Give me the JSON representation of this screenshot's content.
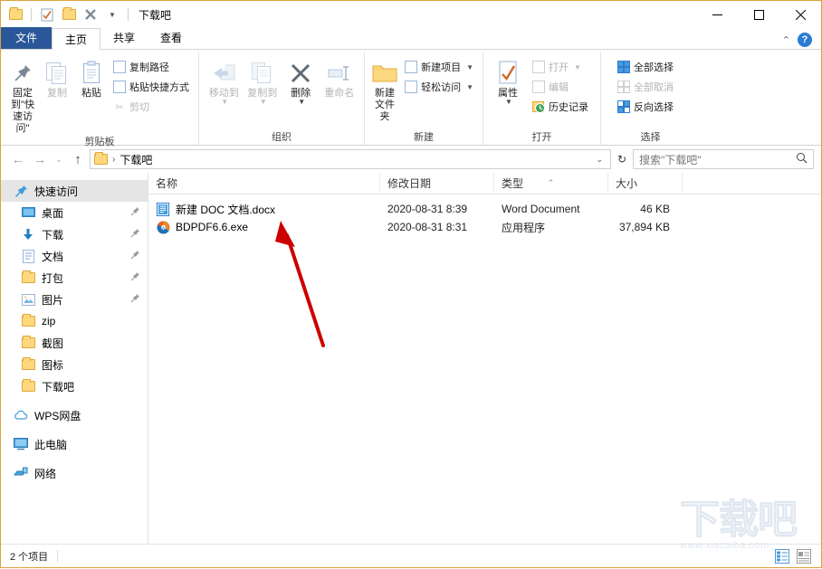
{
  "window": {
    "title": "下载吧",
    "quick_access": [
      {
        "name": "folder-icon",
        "label": "文件夹"
      },
      {
        "name": "properties-icon",
        "label": "属性"
      },
      {
        "name": "new-folder-icon",
        "label": "新建文件夹"
      },
      {
        "name": "delete-icon",
        "label": "删除"
      },
      {
        "name": "customize-icon",
        "label": "自定义快速访问工具栏"
      }
    ],
    "controls": {
      "minimize": "—",
      "maximize": "☐",
      "close": "✕"
    }
  },
  "tabs": [
    {
      "label": "文件",
      "type": "file"
    },
    {
      "label": "主页",
      "type": "active"
    },
    {
      "label": "共享",
      "type": "normal"
    },
    {
      "label": "查看",
      "type": "normal"
    }
  ],
  "ribbon": {
    "collapse_icon": "⌃",
    "help_icon": "?",
    "groups": [
      {
        "label": "剪贴板",
        "big": [
          {
            "label": "固定到\"快速访问\"",
            "icon": "pin-icon",
            "disabled": false
          },
          {
            "label": "复制",
            "icon": "copy-icon",
            "disabled": true
          },
          {
            "label": "粘贴",
            "icon": "paste-icon",
            "disabled": false
          }
        ],
        "small": [
          {
            "label": "复制路径",
            "icon": "copy-path-icon",
            "disabled": false
          },
          {
            "label": "粘贴快捷方式",
            "icon": "paste-shortcut-icon",
            "disabled": false
          },
          {
            "label": "剪切",
            "icon": "cut-icon",
            "disabled": true
          }
        ]
      },
      {
        "label": "组织",
        "big": [
          {
            "label": "移动到",
            "icon": "move-to-icon",
            "disabled": true,
            "caret": true
          },
          {
            "label": "复制到",
            "icon": "copy-to-icon",
            "disabled": true,
            "caret": true
          },
          {
            "label": "删除",
            "icon": "delete-icon",
            "disabled": false,
            "caret": true
          },
          {
            "label": "重命名",
            "icon": "rename-icon",
            "disabled": true
          }
        ]
      },
      {
        "label": "新建",
        "big": [
          {
            "label": "新建文件夹",
            "icon": "new-folder-icon",
            "disabled": false
          }
        ],
        "small": [
          {
            "label": "新建项目",
            "icon": "new-item-icon",
            "disabled": false,
            "caret": true
          },
          {
            "label": "轻松访问",
            "icon": "easy-access-icon",
            "disabled": false,
            "caret": true
          }
        ]
      },
      {
        "label": "打开",
        "big": [
          {
            "label": "属性",
            "icon": "properties-icon",
            "disabled": false,
            "caret": true
          }
        ],
        "small": [
          {
            "label": "打开",
            "icon": "open-icon",
            "disabled": true,
            "caret": true
          },
          {
            "label": "编辑",
            "icon": "edit-icon",
            "disabled": true
          },
          {
            "label": "历史记录",
            "icon": "history-icon",
            "disabled": false
          }
        ]
      },
      {
        "label": "选择",
        "small": [
          {
            "label": "全部选择",
            "icon": "select-all-icon",
            "disabled": false
          },
          {
            "label": "全部取消",
            "icon": "select-none-icon",
            "disabled": true
          },
          {
            "label": "反向选择",
            "icon": "invert-selection-icon",
            "disabled": false
          }
        ]
      }
    ]
  },
  "addressbar": {
    "back_icon": "←",
    "forward_icon": "→",
    "recent_icon": "⌄",
    "up_icon": "↑",
    "path": "下载吧",
    "crumb_sep": "›",
    "dropdown_icon": "⌄",
    "refresh_icon": "↻"
  },
  "search": {
    "placeholder": "搜索\"下载吧\"",
    "icon": "search-icon"
  },
  "sidebar": {
    "items": [
      {
        "label": "快速访问",
        "icon": "quick-access-star-icon",
        "selected": true,
        "root": true,
        "pinned": false
      },
      {
        "label": "桌面",
        "icon": "desktop-icon",
        "pinned": true
      },
      {
        "label": "下载",
        "icon": "downloads-icon",
        "pinned": true
      },
      {
        "label": "文档",
        "icon": "documents-icon",
        "pinned": true
      },
      {
        "label": "打包",
        "icon": "folder-icon",
        "pinned": true
      },
      {
        "label": "图片",
        "icon": "pictures-icon",
        "pinned": true
      },
      {
        "label": "zip",
        "icon": "folder-icon",
        "pinned": false
      },
      {
        "label": "截图",
        "icon": "folder-icon",
        "pinned": false
      },
      {
        "label": "图标",
        "icon": "folder-icon",
        "pinned": false
      },
      {
        "label": "下载吧",
        "icon": "folder-icon",
        "pinned": false
      },
      {
        "label": "WPS网盘",
        "icon": "cloud-icon",
        "root": true,
        "gap": true,
        "pinned": false
      },
      {
        "label": "此电脑",
        "icon": "this-pc-icon",
        "root": true,
        "gap": true,
        "pinned": false
      },
      {
        "label": "网络",
        "icon": "network-icon",
        "root": true,
        "gap": true,
        "pinned": false
      }
    ],
    "pin_icon": "📌"
  },
  "filelist": {
    "columns": [
      {
        "key": "name",
        "label": "名称"
      },
      {
        "key": "date",
        "label": "修改日期"
      },
      {
        "key": "type",
        "label": "类型",
        "sorted": true,
        "sort_icon": "⌃"
      },
      {
        "key": "size",
        "label": "大小"
      }
    ],
    "rows": [
      {
        "name": "新建 DOC 文档.docx",
        "date": "2020-08-31 8:39",
        "type": "Word Document",
        "size": "46 KB",
        "icon": "word-document-icon"
      },
      {
        "name": "BDPDF6.6.exe",
        "date": "2020-08-31 8:31",
        "type": "应用程序",
        "size": "37,894 KB",
        "icon": "application-exe-icon"
      }
    ]
  },
  "statusbar": {
    "item_count": "2 个项目",
    "view_details_icon": "details-view-icon",
    "view_large_icon": "large-icons-view-icon"
  },
  "watermark": {
    "text": "下载吧",
    "url": "www.xiazaiba.com"
  },
  "annotation": {
    "type": "red-arrow",
    "target": "新建 DOC 文档.docx"
  },
  "colors": {
    "file_tab": "#2b579a",
    "folder": "#fdd87d",
    "accent_blue": "#2b7cd3",
    "arrow_red": "#cc0000",
    "window_border": "#d9a441"
  }
}
